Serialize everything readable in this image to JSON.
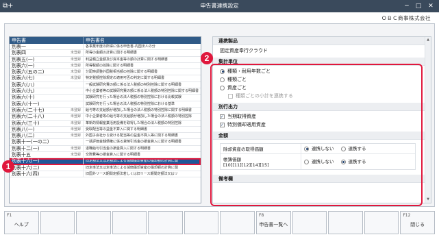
{
  "window": {
    "title": "申告書連携設定",
    "company": "ＯＢＣ商事株式会社"
  },
  "ledger": {
    "headers": [
      "申告書",
      "申告書名"
    ],
    "rows": [
      {
        "name": "別表一",
        "status": "",
        "desc": "各事業年度の所得に係る申告書-内国法人の分"
      },
      {
        "name": "別表四",
        "status": "未登録",
        "desc": "所得の金額の計算に関する明細書"
      },
      {
        "name": "別表五(一)",
        "status": "未登録",
        "desc": "利益積立金額及び資本金等の額の計算に関する明細書"
      },
      {
        "name": "別表六(一)",
        "status": "未登録",
        "desc": "所得税額の控除に関する明細書"
      },
      {
        "name": "別表六(五の二)",
        "status": "未登録",
        "desc": "分配時調整外国税相当額の控除に関する明細書"
      },
      {
        "name": "別表六(七)",
        "status": "未登録",
        "desc": "特定税額控除規定の適用可否の判定に関する明細書"
      },
      {
        "name": "別表六(八)",
        "status": "",
        "desc": "一般試験研究費の額に係る法人税額の特別控除に関する明細書"
      },
      {
        "name": "別表六(九)",
        "status": "",
        "desc": "中小企業者等の試験研究費の額に係る法人税額の特別控除に関する明細書"
      },
      {
        "name": "別表六(十)",
        "status": "",
        "desc": "試験研究を行った場合の法人税額の特別控除における比較試験"
      },
      {
        "name": "別表六(十一)",
        "status": "",
        "desc": "試験研究を行った場合の法人税額の特別控除における基準"
      },
      {
        "name": "別表六(二十七)",
        "status": "未登録",
        "desc": "給与等の支給額が増加した場合の法人税額の特別控除に関する明細書"
      },
      {
        "name": "別表六(二十八)",
        "status": "未登録",
        "desc": "中小企業者等の給与等の支給額が増加した場合の法人税額の特別控除"
      },
      {
        "name": "別表六(三十)",
        "status": "未登録",
        "desc": "革新的情報産業活用設備を取得した場合の法人税額の特別控除"
      },
      {
        "name": "別表八(一)",
        "status": "未登録",
        "desc": "受取配当等の益金不算入に関する明細書"
      },
      {
        "name": "別表八(二)",
        "status": "未登録",
        "desc": "外国子会社から受ける配当等の益金不算入等に関する明細書"
      },
      {
        "name": "別表十一(一の二)",
        "status": "",
        "desc": "一括評価金銭債権に係る貸倒引当金の損金算入に関する明細書"
      },
      {
        "name": "別表十二(一)",
        "status": "未登録",
        "desc": "退職給与引当金の損金算入に関する明細書"
      },
      {
        "name": "別表十五",
        "status": "未登録",
        "desc": "交際費等の損金算入に関する明細書"
      },
      {
        "name": "別表十六(一)",
        "status": "",
        "desc": "旧定額法又は定額法による減価償却資産の償却額の計算に関"
      },
      {
        "name": "別表十六(二)",
        "status": "",
        "desc": "旧定率法又は定率法による減価償却資産の償却額の計算に関"
      },
      {
        "name": "別表十六(四)",
        "status": "",
        "desc": "旧国外リース期間定額法若しくは旧リース期間定額法又はリ"
      }
    ],
    "selected_index": 18
  },
  "badges": {
    "left": "1",
    "right": "2"
  },
  "settings": {
    "product": {
      "title": "連携製品",
      "value": "固定資産奉行クラウド"
    },
    "aggregation": {
      "title": "集計単位",
      "options": [
        "種類・耐用年数ごと",
        "種類ごと",
        "資産ごと"
      ],
      "selected": 0,
      "subtotal_label": "種類ごとの小計を連携する"
    },
    "separate_output": {
      "title": "別行出力",
      "items": [
        "当期取得資産",
        "特別償却適用資産"
      ]
    },
    "amount": {
      "title": "金額",
      "rows": [
        {
          "label": "除却資産の取得価額",
          "options": [
            "連携しない",
            "連携する"
          ],
          "selected": 0
        },
        {
          "label": "帳簿価額",
          "sub": "[10][11][12][14][15]",
          "options": [
            "連携しない",
            "連携する"
          ],
          "selected": 1
        }
      ]
    },
    "remarks": {
      "title": "備考欄"
    }
  },
  "fkeys": [
    {
      "num": "F1",
      "label": "ヘルプ"
    },
    {
      "num": "",
      "label": ""
    },
    {
      "num": "",
      "label": ""
    },
    {
      "num": "",
      "label": ""
    },
    {
      "num": "",
      "label": ""
    },
    {
      "num": "",
      "label": ""
    },
    {
      "num": "",
      "label": ""
    },
    {
      "num": "F8",
      "label": "申告書一覧へ"
    },
    {
      "num": "",
      "label": ""
    },
    {
      "num": "",
      "label": ""
    },
    {
      "num": "",
      "label": ""
    },
    {
      "num": "F12",
      "label": "閉じる"
    }
  ]
}
